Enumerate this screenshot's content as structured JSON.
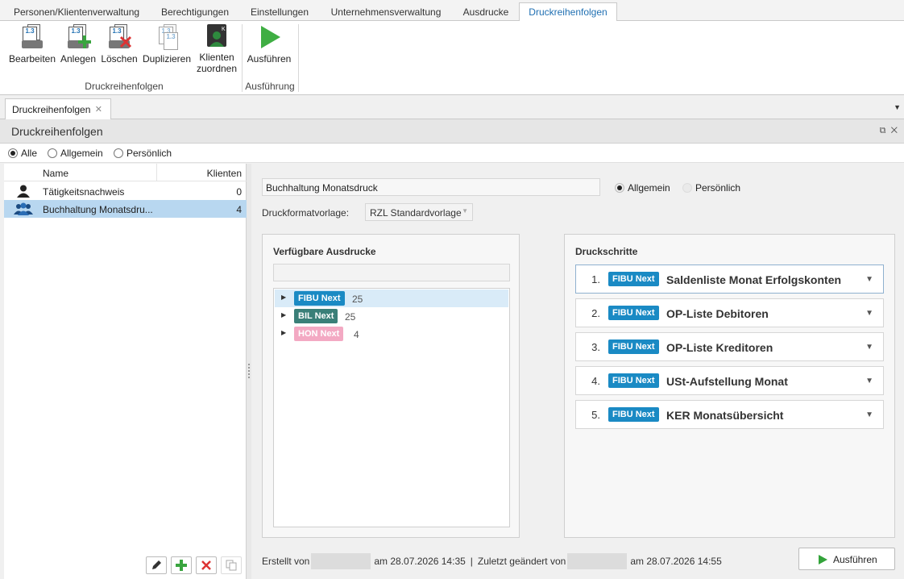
{
  "ribbon_tabs": [
    {
      "label": "Personen/Klientenverwaltung"
    },
    {
      "label": "Berechtigungen"
    },
    {
      "label": "Einstellungen"
    },
    {
      "label": "Unternehmensverwaltung"
    },
    {
      "label": "Ausdrucke"
    },
    {
      "label": "Druckreihenfolgen"
    }
  ],
  "ribbon": {
    "buttons": {
      "edit": "Bearbeiten",
      "create": "Anlegen",
      "delete": "Löschen",
      "duplicate": "Duplizieren",
      "assign_line1": "Klienten",
      "assign_line2": "zuordnen",
      "run": "Ausführen"
    },
    "groups": {
      "sequences": "Druckreihenfolgen",
      "execution": "Ausführung"
    },
    "icon_text": "1.3"
  },
  "doc_tab": {
    "label": "Druckreihenfolgen"
  },
  "panel": {
    "title": "Druckreihenfolgen"
  },
  "filter": {
    "all": "Alle",
    "general": "Allgemein",
    "personal": "Persönlich",
    "selected": "all"
  },
  "list": {
    "col_name": "Name",
    "col_clients": "Klienten",
    "rows": [
      {
        "name": "Tätigkeitsnachweis",
        "clients": "0",
        "icon": "user-icon"
      },
      {
        "name": "Buchhaltung Monatsdru...",
        "clients": "4",
        "icon": "users-icon"
      }
    ]
  },
  "detail": {
    "name_value": "Buchhaltung Monatsdruck",
    "scope_general": "Allgemein",
    "scope_personal": "Persönlich",
    "template_label": "Druckformatvorlage:",
    "template_value": "RZL Standardvorlage",
    "available_title": "Verfügbare Ausdrucke",
    "available": [
      {
        "badge": "FIBU Next",
        "count": "25",
        "color": "#1a8ac4"
      },
      {
        "badge": "BIL Next",
        "count": "25",
        "color": "#3a7f78"
      },
      {
        "badge": "HON Next",
        "count": "4",
        "color": "#f3a9c3"
      }
    ],
    "steps_title": "Druckschritte",
    "steps": [
      {
        "num": "1.",
        "badge": "FIBU Next",
        "title": "Saldenliste Monat Erfolgskonten"
      },
      {
        "num": "2.",
        "badge": "FIBU Next",
        "title": "OP-Liste Debitoren"
      },
      {
        "num": "3.",
        "badge": "FIBU Next",
        "title": "OP-Liste Kreditoren"
      },
      {
        "num": "4.",
        "badge": "FIBU Next",
        "title": "USt-Aufstellung Monat"
      },
      {
        "num": "5.",
        "badge": "FIBU Next",
        "title": "KER Monatsübersicht"
      }
    ],
    "footer": {
      "created_by": "Erstellt von",
      "created_at": "am 28.07.2026 14:35",
      "separator": "|",
      "changed_by": "Zuletzt geändert von",
      "changed_at": "am 28.07.2026 14:55"
    },
    "run_button": "Ausführen"
  },
  "colors": {
    "accent": "#1f6fb2",
    "selection": "#b8d7f0",
    "run_green": "#33a33a",
    "badge_fibu": "#1a8ac4"
  }
}
